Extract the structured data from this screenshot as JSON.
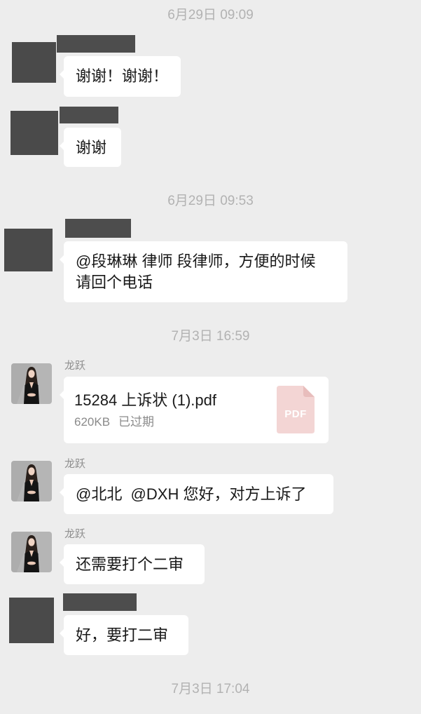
{
  "timestamps": [
    "6月29日 09:09",
    "6月29日 09:53",
    "7月3日 16:59",
    "7月3日 17:04"
  ],
  "messages": [
    {
      "text": "谢谢！谢谢！"
    },
    {
      "text": "谢谢"
    },
    {
      "lines": [
        "@段琳琳 律师 段律师，方便的时候",
        "请回个电话"
      ]
    },
    {
      "sender": "龙跃",
      "file": {
        "name": "15284 上诉状 (1).pdf",
        "size": "620KB",
        "status": "已过期",
        "icon": "pdf-file-icon",
        "icon_label": "PDF"
      }
    },
    {
      "sender": "龙跃",
      "text": "@北北  @DXH 您好，对方上诉了"
    },
    {
      "sender": "龙跃",
      "text": "还需要打个二审"
    },
    {
      "text": "好，要打二审"
    }
  ],
  "colors": {
    "background": "#ededed",
    "bubble": "#ffffff",
    "timestamp": "#b2b2b2",
    "redaction": "#4a4a4a",
    "pdf_icon": "#f3d5d4"
  }
}
